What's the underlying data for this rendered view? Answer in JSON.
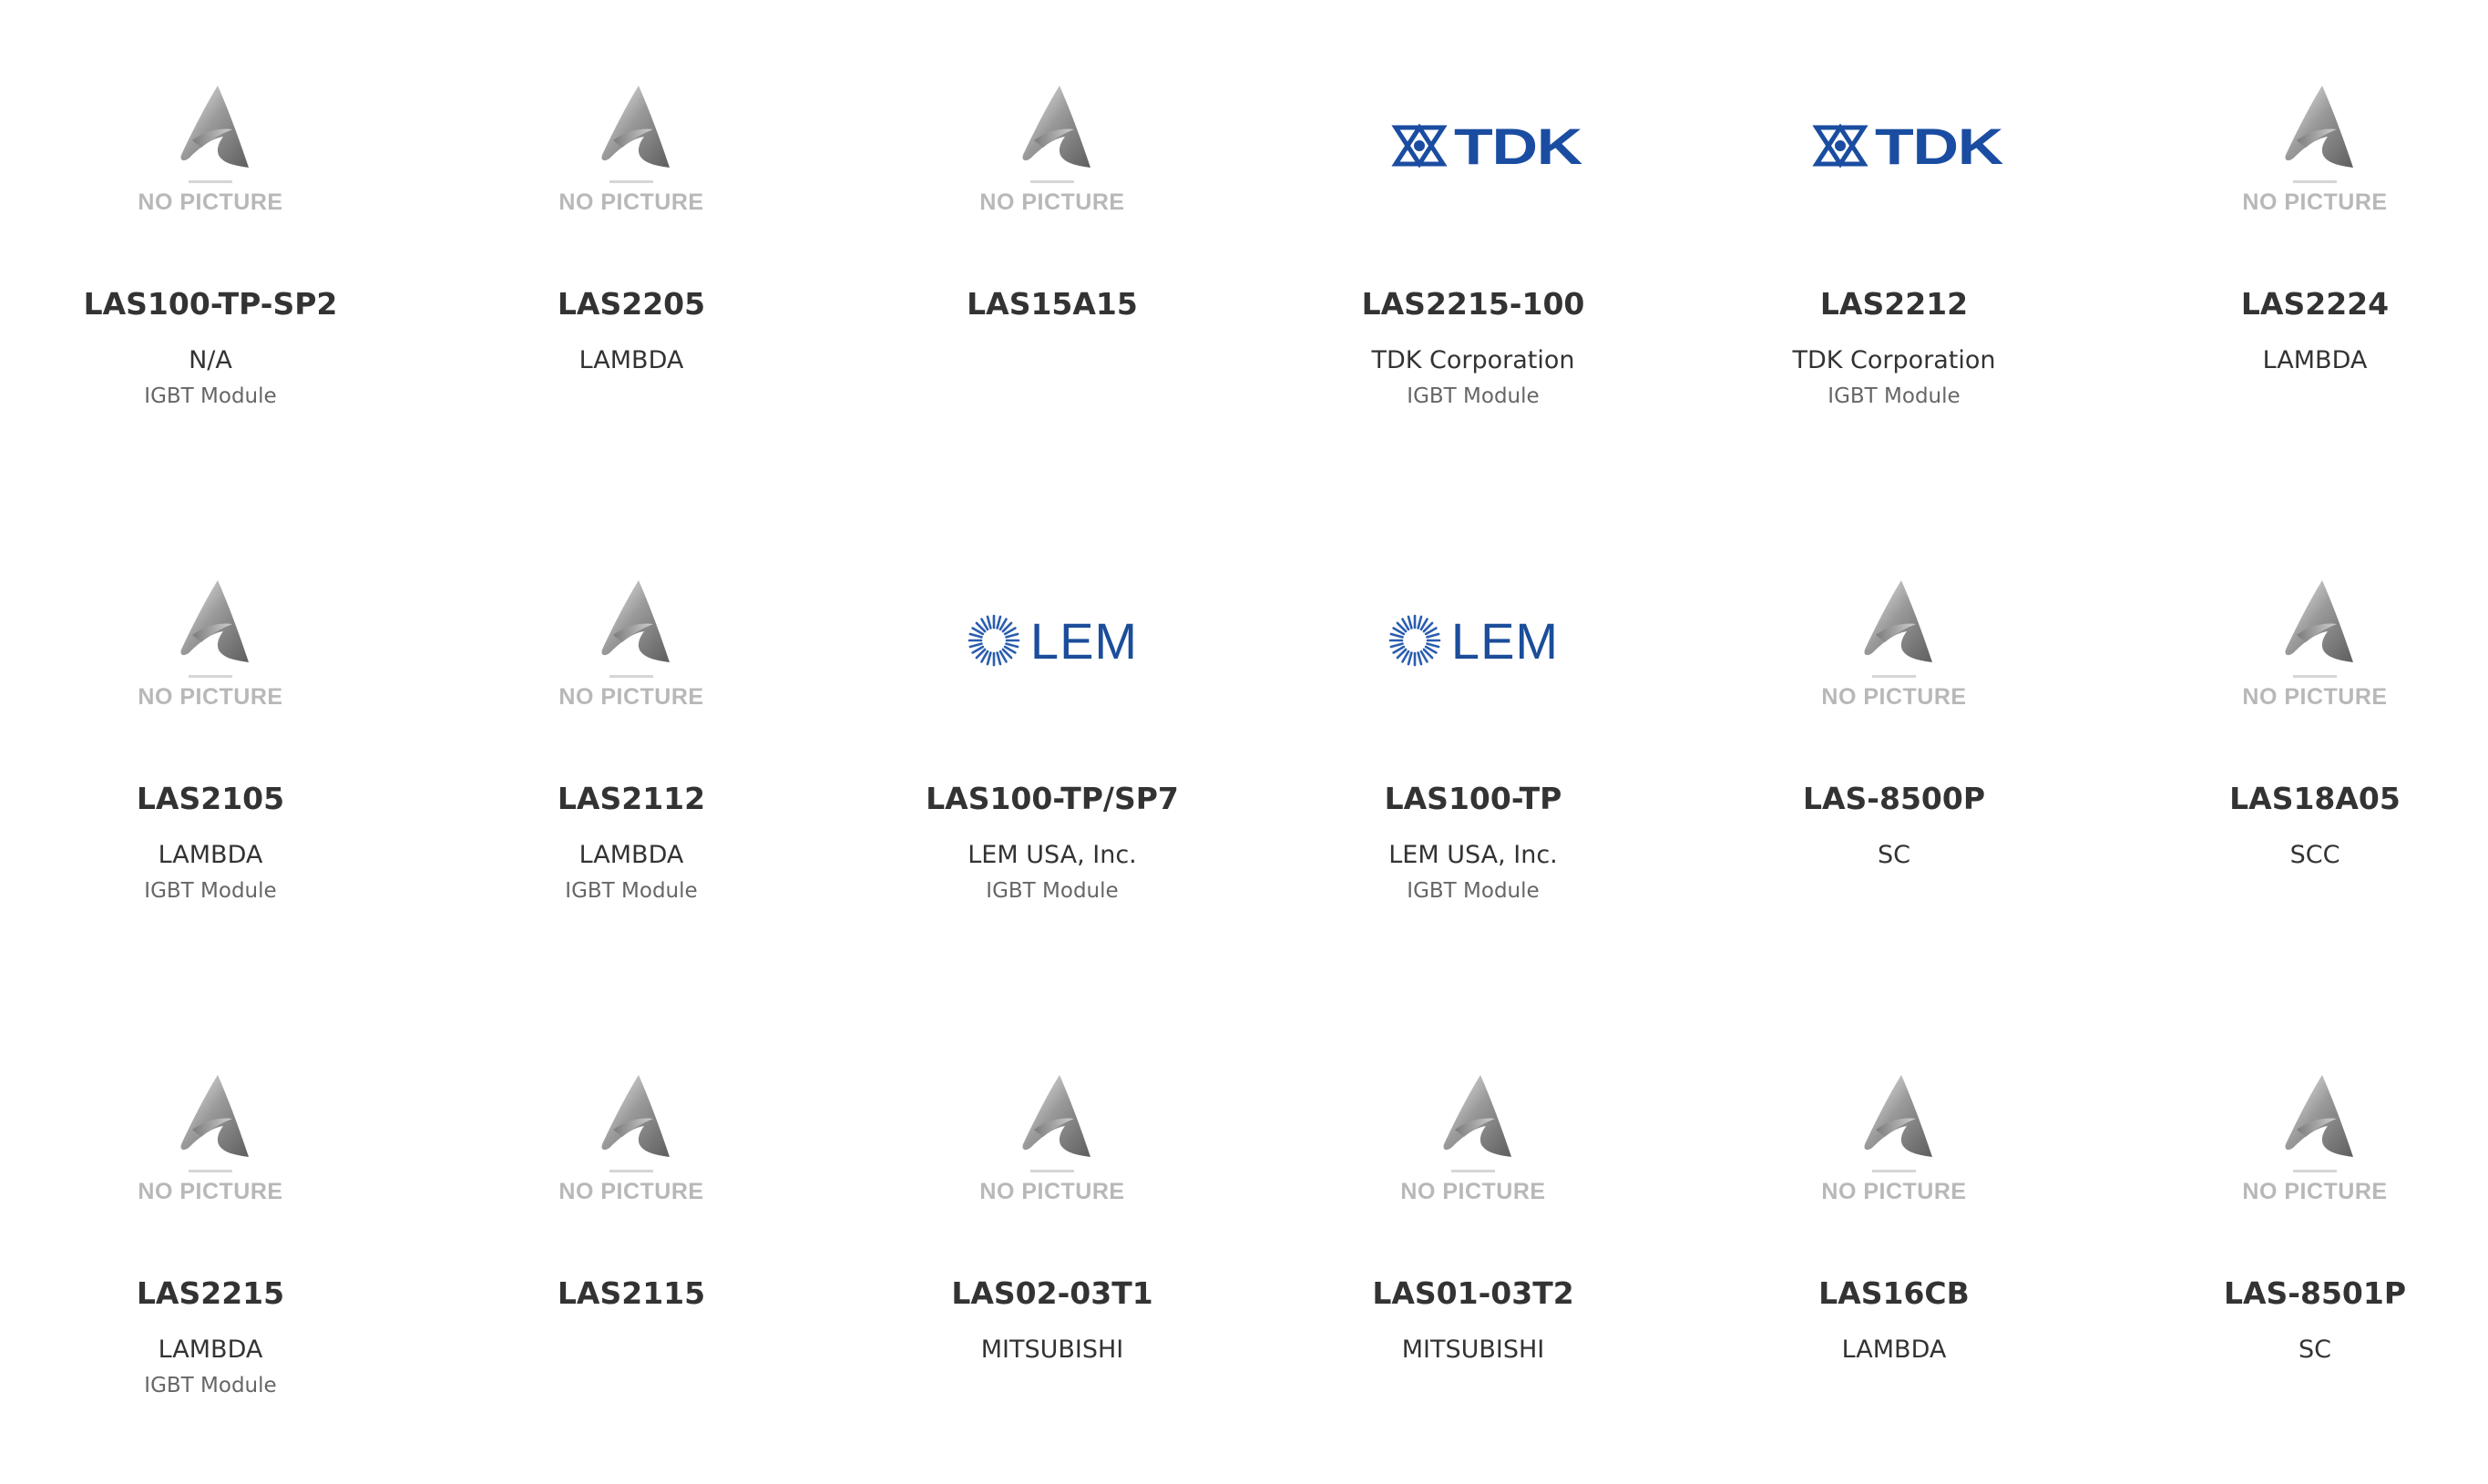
{
  "placeholder_text": "NO PICTURE",
  "colors": {
    "tdk_blue": "#1a4da1",
    "lem_blue": "#1b4d9a",
    "placeholder_gray": "#b8b8b8",
    "text_dark": "#333333",
    "text_muted": "#666666"
  },
  "products": [
    {
      "part": "LAS100-TP-SP2",
      "manufacturer": "N/A",
      "category": "IGBT Module",
      "image": "no-picture"
    },
    {
      "part": "LAS2205",
      "manufacturer": "LAMBDA",
      "category": "",
      "image": "no-picture"
    },
    {
      "part": "LAS15A15",
      "manufacturer": "",
      "category": "",
      "image": "no-picture"
    },
    {
      "part": "LAS2215-100",
      "manufacturer": "TDK Corporation",
      "category": "IGBT Module",
      "image": "tdk-logo",
      "logo_text": "TDK"
    },
    {
      "part": "LAS2212",
      "manufacturer": "TDK Corporation",
      "category": "IGBT Module",
      "image": "tdk-logo",
      "logo_text": "TDK"
    },
    {
      "part": "LAS2224",
      "manufacturer": "LAMBDA",
      "category": "",
      "image": "no-picture"
    },
    {
      "part": "LAS2105",
      "manufacturer": "LAMBDA",
      "category": "IGBT Module",
      "image": "no-picture"
    },
    {
      "part": "LAS2112",
      "manufacturer": "LAMBDA",
      "category": "IGBT Module",
      "image": "no-picture"
    },
    {
      "part": "LAS100-TP/SP7",
      "manufacturer": "LEM USA, Inc.",
      "category": "IGBT Module",
      "image": "lem-logo",
      "logo_text": "LEM"
    },
    {
      "part": "LAS100-TP",
      "manufacturer": "LEM USA, Inc.",
      "category": "IGBT Module",
      "image": "lem-logo",
      "logo_text": "LEM"
    },
    {
      "part": "LAS-8500P",
      "manufacturer": "SC",
      "category": "",
      "image": "no-picture"
    },
    {
      "part": "LAS18A05",
      "manufacturer": "SCC",
      "category": "",
      "image": "no-picture"
    },
    {
      "part": "LAS2215",
      "manufacturer": "LAMBDA",
      "category": "IGBT Module",
      "image": "no-picture"
    },
    {
      "part": "LAS2115",
      "manufacturer": "",
      "category": "",
      "image": "no-picture"
    },
    {
      "part": "LAS02-03T1",
      "manufacturer": "MITSUBISHI",
      "category": "",
      "image": "no-picture"
    },
    {
      "part": "LAS01-03T2",
      "manufacturer": "MITSUBISHI",
      "category": "",
      "image": "no-picture"
    },
    {
      "part": "LAS16CB",
      "manufacturer": "LAMBDA",
      "category": "",
      "image": "no-picture"
    },
    {
      "part": "LAS-8501P",
      "manufacturer": "SC",
      "category": "",
      "image": "no-picture"
    }
  ]
}
